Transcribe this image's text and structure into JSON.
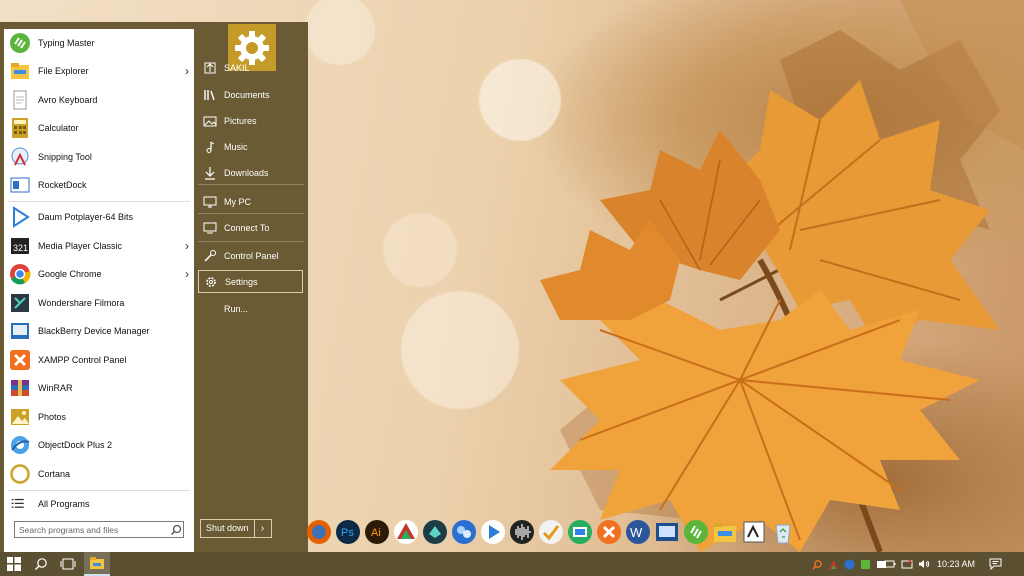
{
  "start_menu": {
    "apps": [
      {
        "label": "Typing Master",
        "icon": "typing-master-icon",
        "has_submenu": false
      },
      {
        "label": "File Explorer",
        "icon": "file-explorer-icon",
        "has_submenu": true
      },
      {
        "label": "Avro Keyboard",
        "icon": "avro-keyboard-icon",
        "has_submenu": false
      },
      {
        "label": "Calculator",
        "icon": "calculator-icon",
        "has_submenu": false
      },
      {
        "label": "Snipping Tool",
        "icon": "snipping-tool-icon",
        "has_submenu": false
      },
      {
        "label": "RocketDock",
        "icon": "rocketdock-icon",
        "has_submenu": false
      },
      {
        "label": "Daum Potplayer-64 Bits",
        "icon": "potplayer-icon",
        "has_submenu": false
      },
      {
        "label": "Media Player Classic",
        "icon": "media-player-classic-icon",
        "has_submenu": true
      },
      {
        "label": "Google Chrome",
        "icon": "chrome-icon",
        "has_submenu": true
      },
      {
        "label": "Wondershare Filmora",
        "icon": "filmora-icon",
        "has_submenu": false
      },
      {
        "label": "BlackBerry Device Manager",
        "icon": "blackberry-icon",
        "has_submenu": false
      },
      {
        "label": "XAMPP Control Panel",
        "icon": "xampp-icon",
        "has_submenu": false
      },
      {
        "label": "WinRAR",
        "icon": "winrar-icon",
        "has_submenu": false
      },
      {
        "label": "Photos",
        "icon": "photos-icon",
        "has_submenu": false
      },
      {
        "label": "ObjectDock Plus 2",
        "icon": "objectdock-icon",
        "has_submenu": false
      },
      {
        "label": "Cortana",
        "icon": "cortana-icon",
        "has_submenu": false
      }
    ],
    "all_programs": "All Programs",
    "search_placeholder": "Search programs and files",
    "places": [
      {
        "label": "SAKIL",
        "icon": "user-icon"
      },
      {
        "label": "Documents",
        "icon": "documents-icon"
      },
      {
        "label": "Pictures",
        "icon": "pictures-icon"
      },
      {
        "label": "Music",
        "icon": "music-icon"
      },
      {
        "label": "Downloads",
        "icon": "downloads-icon"
      },
      {
        "label": "My PC",
        "icon": "computer-icon"
      },
      {
        "label": "Connect To",
        "icon": "connect-icon"
      },
      {
        "label": "Control Panel",
        "icon": "control-panel-icon"
      },
      {
        "label": "Settings",
        "icon": "settings-icon",
        "selected": true
      },
      {
        "label": "Run...",
        "icon": "run-icon"
      }
    ],
    "shutdown_label": "Shut down",
    "accent_color": "#c49b28",
    "panel_color": "#6b5b35"
  },
  "dock": {
    "items": [
      "firefox-icon",
      "photoshop-icon",
      "illustrator-icon",
      "access-icon",
      "app-icon",
      "app-icon",
      "potplayer-icon",
      "audio-icon",
      "flag-icon",
      "screen-icon",
      "xampp-icon",
      "word-icon",
      "media-icon",
      "typing-master-icon",
      "folder-icon",
      "avro-icon",
      "recycle-bin-icon"
    ]
  },
  "taskbar": {
    "time": "10:23 AM",
    "color": "#5b5032"
  }
}
